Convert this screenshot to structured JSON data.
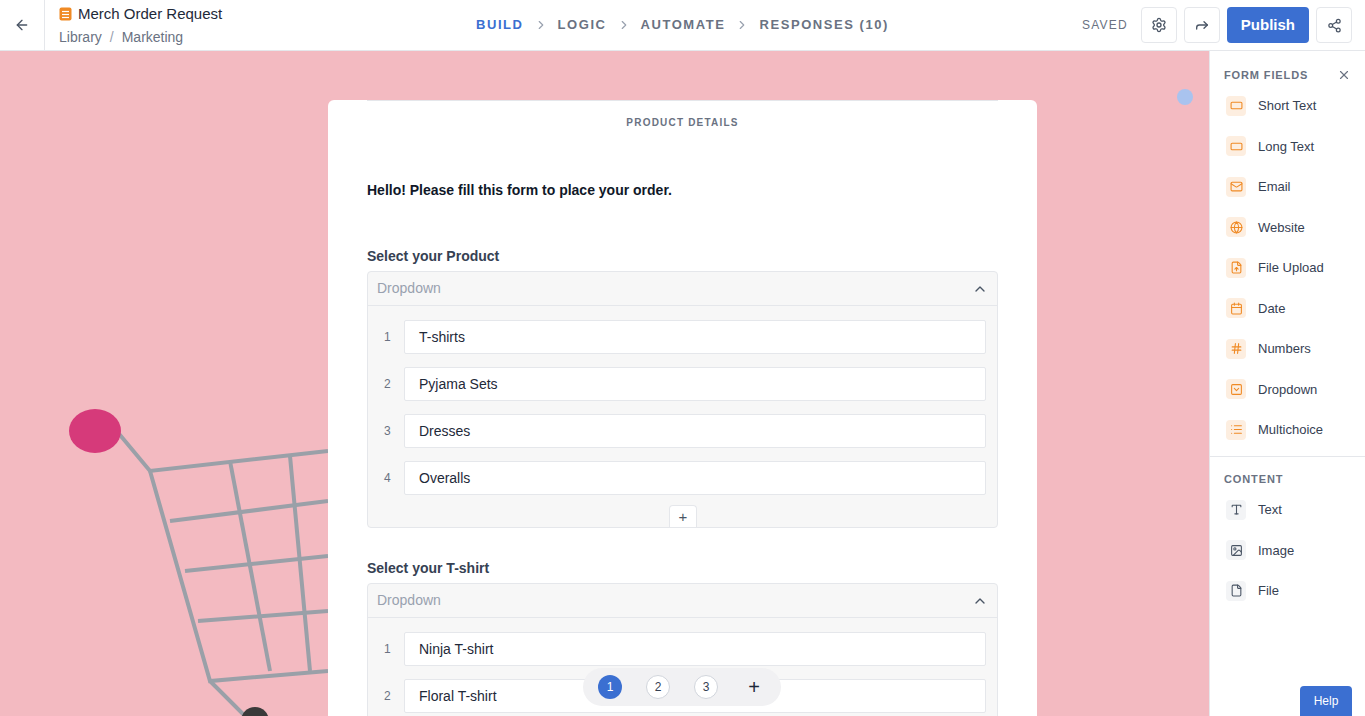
{
  "header": {
    "title": "Merch Order Request",
    "breadcrumb": [
      "Library",
      "Marketing"
    ],
    "breadcrumb_separator": "/",
    "steps": [
      {
        "label": "BUILD",
        "selected": true
      },
      {
        "label": "LOGIC",
        "selected": false
      },
      {
        "label": "AUTOMATE",
        "selected": false
      },
      {
        "label": "RESPONSES (10)",
        "selected": false
      }
    ],
    "status": "SAVED",
    "publish": "Publish"
  },
  "form": {
    "section": "PRODUCT DETAILS",
    "intro": "Hello! Please fill this form to place your order.",
    "questions": [
      {
        "label": "Select your Product",
        "placeholder": "Dropdown",
        "expanded": true,
        "add": "+",
        "options": [
          {
            "number": "1",
            "text": "T-shirts"
          },
          {
            "number": "2",
            "text": "Pyjama Sets"
          },
          {
            "number": "3",
            "text": "Dresses"
          },
          {
            "number": "4",
            "text": "Overalls"
          }
        ]
      },
      {
        "label": "Select your T-shirt",
        "placeholder": "Dropdown",
        "expanded": true,
        "add": "+",
        "options": [
          {
            "number": "1",
            "text": "Ninja T-shirt"
          },
          {
            "number": "2",
            "text": "Floral T-shirt"
          }
        ]
      }
    ]
  },
  "pages": [
    {
      "label": "1",
      "selected": true
    },
    {
      "label": "2",
      "selected": false
    },
    {
      "label": "3",
      "selected": false
    }
  ],
  "add_page": "+",
  "sidebar": {
    "sections": [
      {
        "title": "FORM FIELDS",
        "kind": "fields",
        "items": [
          "Short Text",
          "Long Text",
          "Email",
          "Website",
          "File Upload",
          "Date",
          "Numbers",
          "Dropdown",
          "Multichoice"
        ]
      },
      {
        "title": "CONTENT",
        "kind": "content",
        "items": [
          "Text",
          "Image",
          "File"
        ]
      }
    ]
  },
  "help": "Help"
}
